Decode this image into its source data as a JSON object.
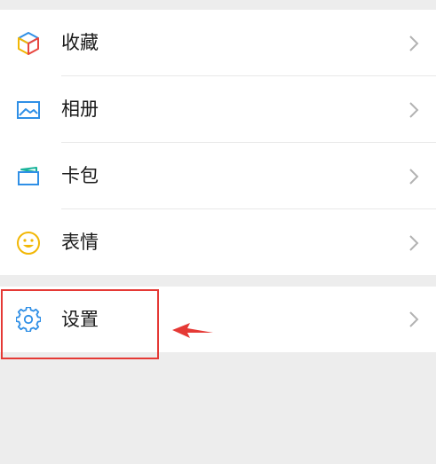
{
  "menu": {
    "items": [
      {
        "label": "收藏",
        "icon": "favorites-cube-icon"
      },
      {
        "label": "相册",
        "icon": "album-picture-icon"
      },
      {
        "label": "卡包",
        "icon": "card-wallet-icon"
      },
      {
        "label": "表情",
        "icon": "sticker-smiley-icon"
      }
    ],
    "settings": {
      "label": "设置",
      "icon": "gear-icon"
    }
  },
  "annotation": {
    "color": "#e53935"
  },
  "colors": {
    "background": "#ededed",
    "row_background": "#ffffff",
    "icon_blue": "#2f8fe6",
    "chevron": "#b2b2b2"
  }
}
